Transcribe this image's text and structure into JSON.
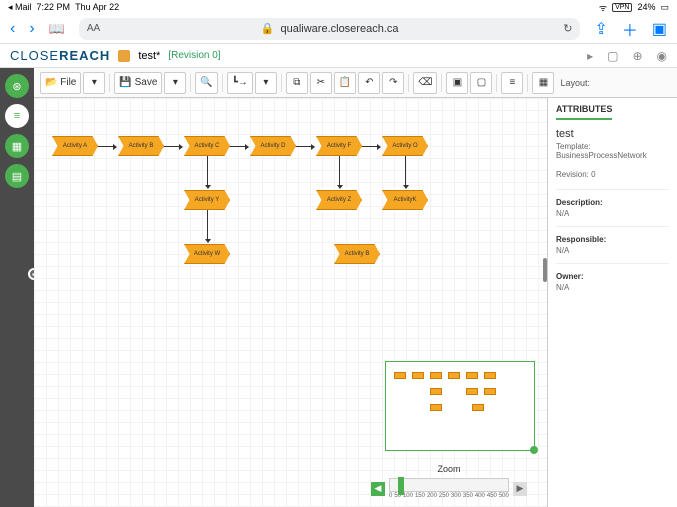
{
  "status": {
    "back_app": "◂ Mail",
    "time": "7:22 PM",
    "date": "Thu Apr 22",
    "wifi": "ᯤ",
    "vpn": "VPN",
    "battery": "24%",
    "batt_icon": "▭"
  },
  "safari": {
    "back": "‹",
    "fwd": "›",
    "aa": "AA",
    "lock": "🔒",
    "url": "qualiware.closereach.ca",
    "reload": "↻",
    "share": "⇪",
    "add": "＋",
    "tabs": "▣"
  },
  "header": {
    "logo_a": "CLOSE",
    "logo_b": "REACH",
    "title": "test",
    "star": "*",
    "revision": "[Revision 0]",
    "icons": {
      "video": "▸",
      "screen": "▢",
      "globe": "⊕",
      "user": "◉"
    }
  },
  "rail": {
    "i1": "⊛",
    "i2": "≡",
    "i3": "▦",
    "i4": "▤",
    "handle": "▸"
  },
  "toolbar": {
    "file_icon": "📂",
    "file": "File",
    "file_dd": "▾",
    "save_icon": "💾",
    "save": "Save",
    "save_dd": "▾",
    "find": "🔍",
    "conn": "┗→",
    "conn_dd": "▾",
    "copy": "⧉",
    "cut": "✂",
    "paste": "📋",
    "undo": "↶",
    "redo": "↷",
    "del": "⌫",
    "front": "▣",
    "back_i": "▢",
    "align": "≡",
    "grid": "▦",
    "layout_label": "Layout:"
  },
  "activities": {
    "a": "Activity A",
    "b": "Activity B",
    "c": "Activity C",
    "d": "Activity D",
    "f": "Activity F",
    "o": "Activity O",
    "y": "Activity Y",
    "z": "Activity Z",
    "k": "ActivityK",
    "w": "Activity W",
    "b2": "Activity B"
  },
  "minimap": {},
  "zoom": {
    "label": "Zoom",
    "minus": "◀",
    "plus": "▶",
    "t0": "0",
    "t50": "50",
    "t100": "100",
    "t150": "150",
    "t200": "200",
    "t250": "250",
    "t300": "300",
    "t350": "350",
    "t400": "400",
    "t450": "450",
    "t500": "500"
  },
  "attributes": {
    "tab": "ATTRIBUTES",
    "title": "test",
    "template": "Template: BusinessProcessNetwork",
    "revision": "Revision: 0",
    "desc_label": "Description:",
    "desc_val": "N/A",
    "resp_label": "Responsible:",
    "resp_val": "N/A",
    "owner_label": "Owner:",
    "owner_val": "N/A"
  }
}
